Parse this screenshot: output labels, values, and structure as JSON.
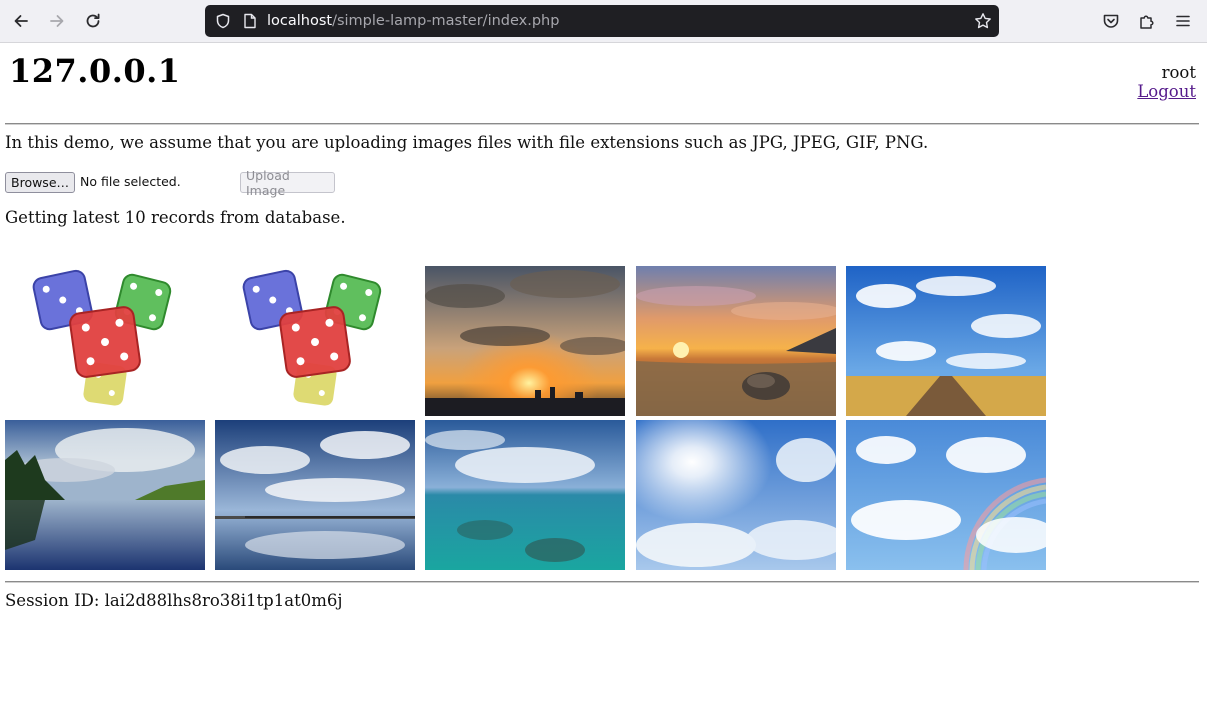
{
  "browser": {
    "back_icon": "arrow-left-icon",
    "forward_icon": "arrow-right-icon",
    "reload_icon": "reload-icon",
    "url_host": "localhost",
    "url_path": "/simple-lamp-master/index.php",
    "shield_icon": "shield-icon",
    "page_icon": "page-icon",
    "bookmark_icon": "star-icon",
    "pocket_icon": "pocket-icon",
    "extensions_icon": "puzzle-icon",
    "menu_icon": "hamburger-menu-icon"
  },
  "header": {
    "title": "127.0.0.1",
    "username": "root",
    "logout_label": "Logout"
  },
  "intro_text": "In this demo, we assume that you are uploading images files with file extensions such as JPG, JPEG, GIF, PNG.",
  "upload": {
    "browse_label": "Browse…",
    "file_status": "No file selected.",
    "upload_label": "Upload Image"
  },
  "records_text": "Getting latest 10 records from database.",
  "gallery": {
    "images": [
      {
        "subject": "dice"
      },
      {
        "subject": "dice"
      },
      {
        "subject": "sunset-clouds-city"
      },
      {
        "subject": "beach-sunset"
      },
      {
        "subject": "sky-road"
      },
      {
        "subject": "lake-reflection"
      },
      {
        "subject": "pier-clouds"
      },
      {
        "subject": "turquoise-sea"
      },
      {
        "subject": "sun-clouds"
      },
      {
        "subject": "rainbow-clouds"
      }
    ]
  },
  "session_text": "Session ID: lai2d88lhs8ro38i1tp1at0m6j",
  "colors": {
    "toolbar_bg": "#f0f0f4",
    "urlbar_bg": "#1f1f23",
    "link_visited": "#551a8b"
  }
}
